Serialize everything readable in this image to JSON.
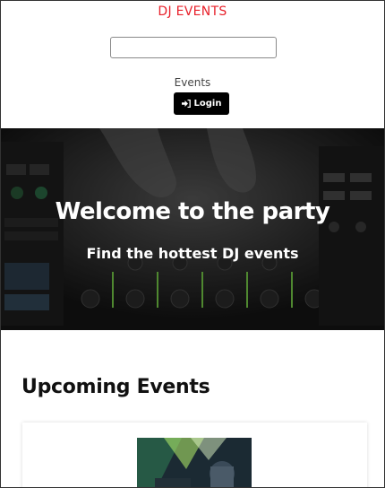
{
  "header": {
    "brand": "DJ EVENTS",
    "search": {
      "value": "",
      "placeholder": ""
    },
    "nav_events": "Events",
    "login_label": "Login"
  },
  "hero": {
    "title": "Welcome to the party",
    "subtitle": "Find the hottest DJ events"
  },
  "upcoming": {
    "title": "Upcoming Events"
  },
  "colors": {
    "brand": "#e8202a",
    "button_bg": "#000000",
    "hero_overlay": "#151515"
  },
  "icons": {
    "login": "sign-in-icon"
  }
}
